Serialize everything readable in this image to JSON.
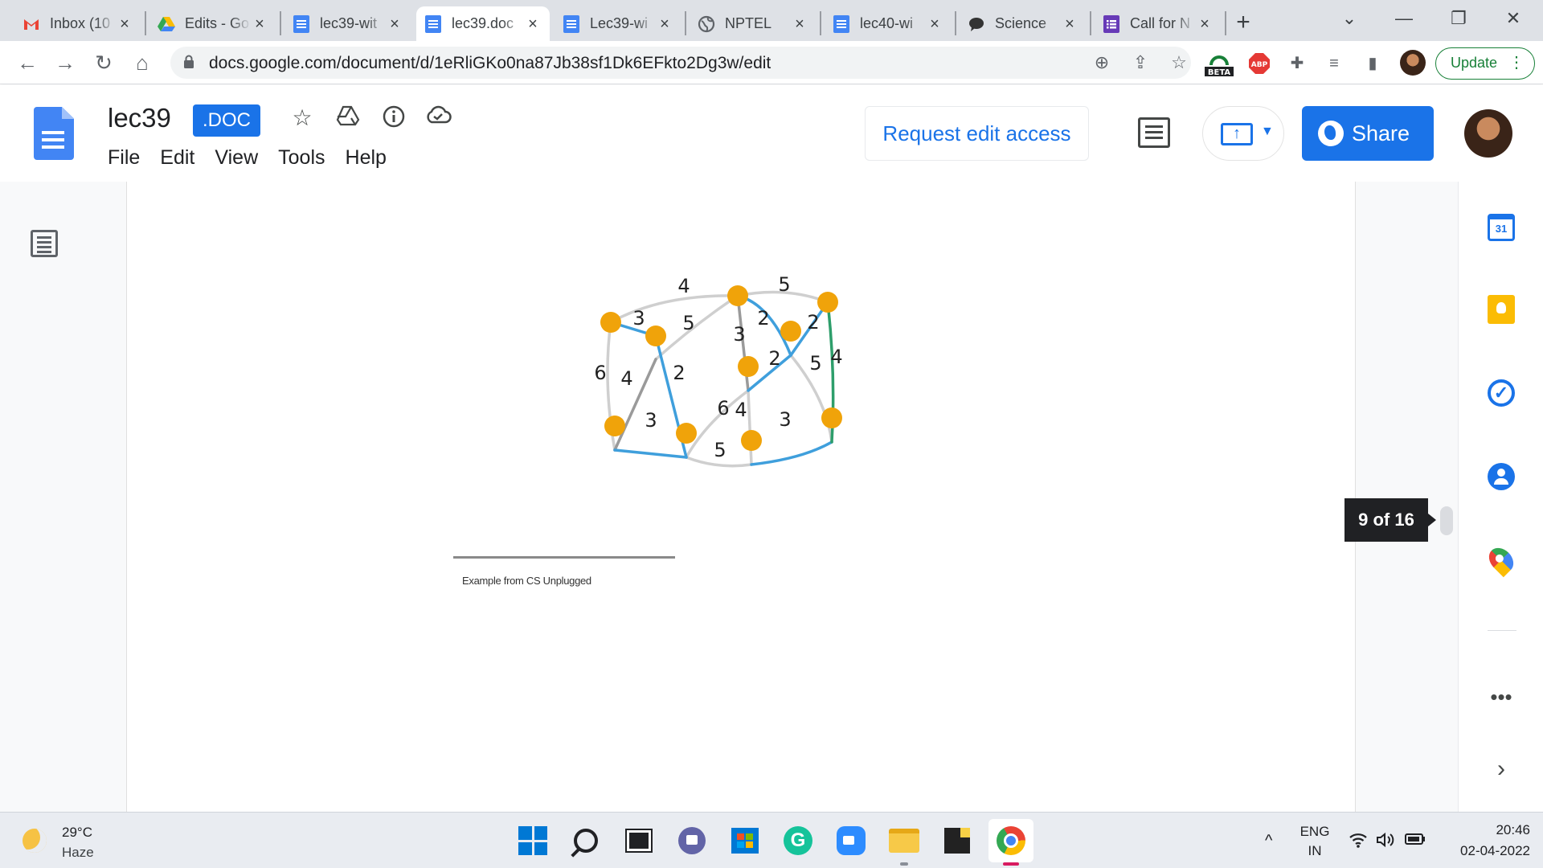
{
  "browser": {
    "tabs": [
      {
        "title": "Inbox (10",
        "favicon": "gmail-icon"
      },
      {
        "title": "Edits - Go",
        "favicon": "drive-icon"
      },
      {
        "title": "lec39-wit",
        "favicon": "docs-icon"
      },
      {
        "title": "lec39.doc",
        "favicon": "docs-icon",
        "active": true
      },
      {
        "title": "Lec39-wi",
        "favicon": "docs-icon"
      },
      {
        "title": "NPTEL",
        "favicon": "globe-icon"
      },
      {
        "title": "lec40-wi",
        "favicon": "docs-icon"
      },
      {
        "title": "Science",
        "favicon": "chat-icon"
      },
      {
        "title": "Call for N",
        "favicon": "forms-icon"
      }
    ],
    "url": "docs.google.com/document/d/1eRliGKo0na87Jb38sf1Dk6EFkto2Dg3w/edit",
    "update_label": "Update",
    "ext_beta_label": "BETA",
    "ext_abp_label": "ABP"
  },
  "docs": {
    "title": "lec39",
    "badge": ".DOC",
    "menu": [
      "File",
      "Edit",
      "View",
      "Tools",
      "Help"
    ],
    "request_access_label": "Request edit access",
    "share_label": "Share"
  },
  "document": {
    "footnote": "Example from CS Unplugged",
    "page_counter": "9 of 16"
  },
  "graph": {
    "edge_weights": [
      "4",
      "5",
      "3",
      "5",
      "3",
      "2",
      "2",
      "6",
      "4",
      "2",
      "2",
      "5",
      "4",
      "6",
      "4",
      "3",
      "3",
      "5"
    ],
    "colors": {
      "node": "#f0a30a",
      "tree_edge": "#3f9fdc",
      "other_edge": "#cfcfcf",
      "highlight_edge": "#2e9e6b"
    }
  },
  "side_panel": {
    "calendar_day": "31"
  },
  "taskbar": {
    "weather_temp": "29°C",
    "weather_desc": "Haze",
    "lang_top": "ENG",
    "lang_bottom": "IN",
    "time": "20:46",
    "date": "02-04-2022"
  }
}
